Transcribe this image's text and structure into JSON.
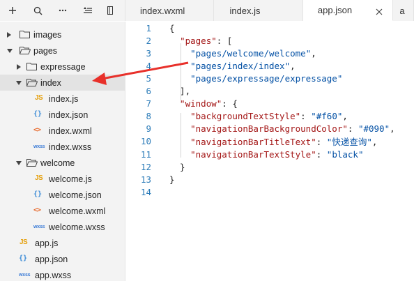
{
  "tabs": [
    {
      "label": "index.wxml",
      "active": false
    },
    {
      "label": "index.js",
      "active": false
    },
    {
      "label": "app.json",
      "active": true
    },
    {
      "label": "a",
      "active": false
    }
  ],
  "toolbar": {
    "icons": [
      "plus-icon",
      "search-icon",
      "more-icon",
      "collapse-icon",
      "split-icon"
    ]
  },
  "tree": [
    {
      "label": "images",
      "type": "folder",
      "expanded": false,
      "depth": 0
    },
    {
      "label": "pages",
      "type": "folder",
      "expanded": true,
      "depth": 0
    },
    {
      "label": "expressage",
      "type": "folder",
      "expanded": false,
      "depth": 1
    },
    {
      "label": "index",
      "type": "folder",
      "expanded": true,
      "depth": 1,
      "selected": true
    },
    {
      "label": "index.js",
      "type": "js",
      "depth": 2,
      "icon_text": "JS"
    },
    {
      "label": "index.json",
      "type": "json",
      "depth": 2,
      "icon_text": "{}"
    },
    {
      "label": "index.wxml",
      "type": "wxml",
      "depth": 2,
      "icon_text": "<>"
    },
    {
      "label": "index.wxss",
      "type": "wxss",
      "depth": 2,
      "icon_text": "wxss"
    },
    {
      "label": "welcome",
      "type": "folder",
      "expanded": true,
      "depth": 1
    },
    {
      "label": "welcome.js",
      "type": "js",
      "depth": 2,
      "icon_text": "JS"
    },
    {
      "label": "welcome.json",
      "type": "json",
      "depth": 2,
      "icon_text": "{}"
    },
    {
      "label": "welcome.wxml",
      "type": "wxml",
      "depth": 2,
      "icon_text": "<>"
    },
    {
      "label": "welcome.wxss",
      "type": "wxss",
      "depth": 2,
      "icon_text": "wxss"
    },
    {
      "label": "app.js",
      "type": "js",
      "depth": 0,
      "icon_text": "JS"
    },
    {
      "label": "app.json",
      "type": "json",
      "depth": 0,
      "icon_text": "{}"
    },
    {
      "label": "app.wxss",
      "type": "wxss",
      "depth": 0,
      "icon_text": "wxss"
    }
  ],
  "editor": {
    "lines": [
      {
        "num": "1",
        "tokens": [
          [
            "punc",
            "{"
          ]
        ]
      },
      {
        "num": "2",
        "tokens": [
          [
            "punc",
            "  "
          ],
          [
            "key",
            "\"pages\""
          ],
          [
            "punc",
            ": ["
          ]
        ]
      },
      {
        "num": "3",
        "tokens": [
          [
            "punc",
            "    "
          ],
          [
            "str",
            "\"pages/welcome/welcome\""
          ],
          [
            "punc",
            ","
          ]
        ]
      },
      {
        "num": "4",
        "tokens": [
          [
            "punc",
            "    "
          ],
          [
            "str",
            "\"pages/index/index\""
          ],
          [
            "punc",
            ","
          ]
        ]
      },
      {
        "num": "5",
        "tokens": [
          [
            "punc",
            "    "
          ],
          [
            "str",
            "\"pages/expressage/expressage\""
          ]
        ]
      },
      {
        "num": "6",
        "tokens": [
          [
            "punc",
            "  ],"
          ]
        ]
      },
      {
        "num": "7",
        "tokens": [
          [
            "punc",
            "  "
          ],
          [
            "key",
            "\"window\""
          ],
          [
            "punc",
            ": {"
          ]
        ]
      },
      {
        "num": "8",
        "tokens": [
          [
            "punc",
            "    "
          ],
          [
            "key",
            "\"backgroundTextStyle\""
          ],
          [
            "punc",
            ": "
          ],
          [
            "str",
            "\"#f60\""
          ],
          [
            "punc",
            ","
          ]
        ]
      },
      {
        "num": "9",
        "tokens": [
          [
            "punc",
            "    "
          ],
          [
            "key",
            "\"navigationBarBackgroundColor\""
          ],
          [
            "punc",
            ": "
          ],
          [
            "str",
            "\"#090\""
          ],
          [
            "punc",
            ","
          ]
        ]
      },
      {
        "num": "10",
        "tokens": [
          [
            "punc",
            "    "
          ],
          [
            "key",
            "\"navigationBarTitleText\""
          ],
          [
            "punc",
            ": "
          ],
          [
            "str",
            "\"快递查询\""
          ],
          [
            "punc",
            ","
          ]
        ]
      },
      {
        "num": "11",
        "tokens": [
          [
            "punc",
            "    "
          ],
          [
            "key",
            "\"navigationBarTextStyle\""
          ],
          [
            "punc",
            ": "
          ],
          [
            "str",
            "\"black\""
          ]
        ]
      },
      {
        "num": "12",
        "tokens": [
          [
            "punc",
            "  }"
          ]
        ]
      },
      {
        "num": "13",
        "tokens": [
          [
            "punc",
            "}"
          ]
        ]
      },
      {
        "num": "14",
        "tokens": []
      }
    ]
  },
  "colors": {
    "key": "#a31515",
    "string": "#0451a5",
    "line_number": "#2b7bb8",
    "arrow": "#e8302a"
  }
}
